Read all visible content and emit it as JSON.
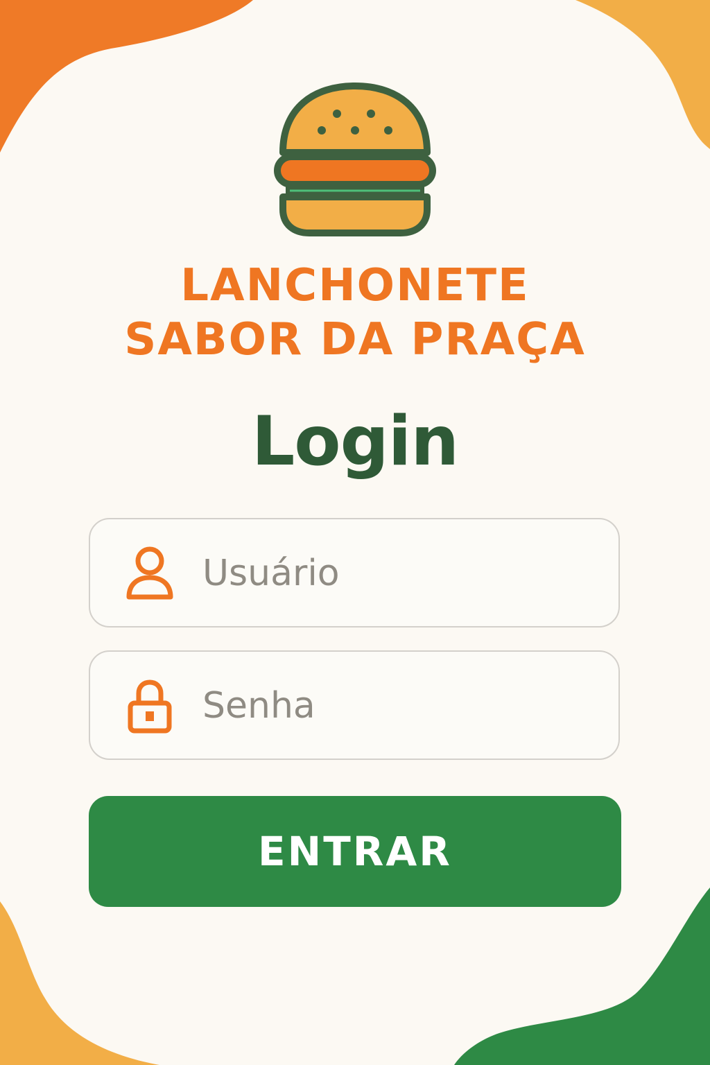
{
  "brand": {
    "line1": "LANCHONETE",
    "line2": "SABOR DA PRAÇA"
  },
  "login": {
    "title": "Login",
    "username": {
      "placeholder": "Usuário",
      "value": ""
    },
    "password": {
      "placeholder": "Senha",
      "value": ""
    },
    "submit_label": "ENTRAR"
  },
  "icons": {
    "logo": "burger-icon",
    "username": "user-icon",
    "password": "lock-icon"
  },
  "colors": {
    "accent_orange": "#ef7622",
    "light_orange": "#f2ae47",
    "dark_green": "#2f5a37",
    "button_green": "#2e8a45",
    "background": "#fcf9f3"
  }
}
